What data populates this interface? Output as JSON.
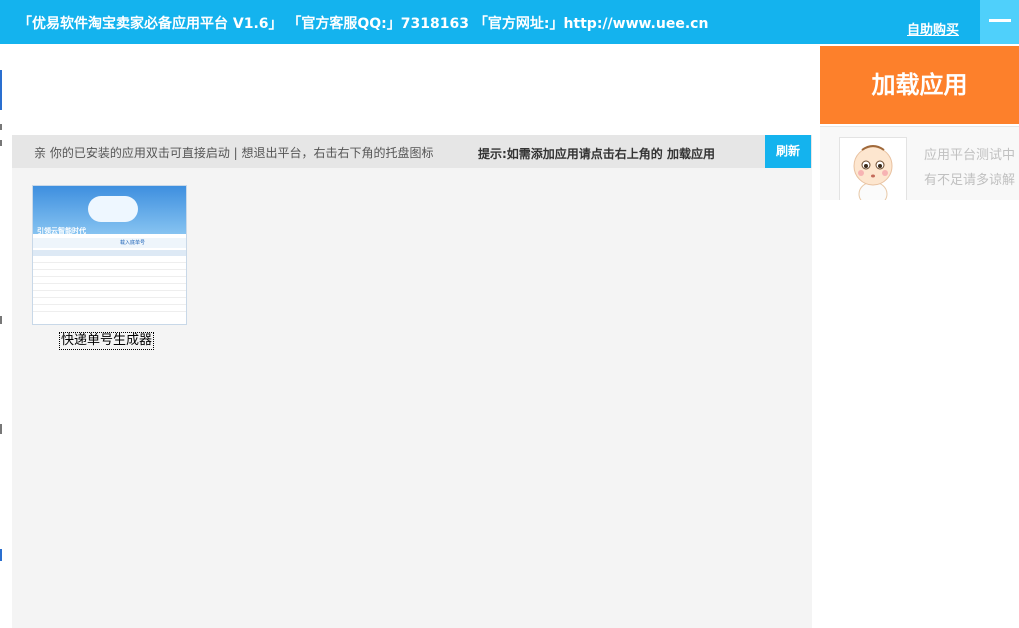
{
  "window": {
    "title": "「优易软件淘宝卖家必备应用平台 V1.6」 「官方客服QQ:」7318163 「官方网址:」http://www.uee.cn",
    "buy_link": "自助购买",
    "minimize_icon": "minimize-icon"
  },
  "main": {
    "hint": "亲  你的已安装的应用双击可直接启动  |  想退出平台，右击右下角的托盘图标",
    "tip": "提示:如需添加应用请点击右上角的  加载应用",
    "refresh_label": "刷新",
    "apps": [
      {
        "label": "快递单号生成器",
        "thumbnail": {
          "brand": "引领云智能时代",
          "search_label": "载入底单号"
        }
      }
    ]
  },
  "sidebar": {
    "load_label": "加载应用",
    "notice_line1": "应用平台测试中",
    "notice_line2": "有不足请多谅解",
    "avatar_icon": "cartoon-baby-avatar"
  },
  "colors": {
    "primary_blue": "#14b3ee",
    "minimize_bg": "#4fd0fb",
    "load_orange": "#fd802b",
    "content_bg": "#f4f4f4",
    "hint_bar_bg": "#e6e6e6"
  }
}
